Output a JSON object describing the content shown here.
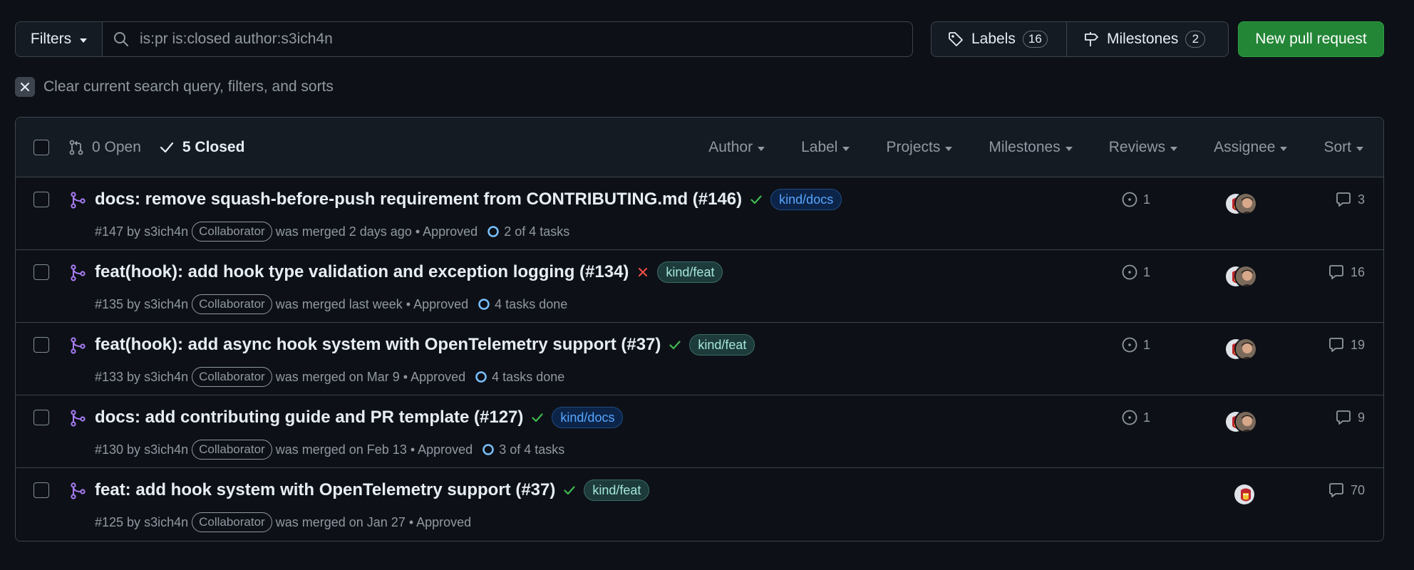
{
  "toolbar": {
    "filters_label": "Filters",
    "search_value": "is:pr is:closed author:s3ich4n",
    "labels_label": "Labels",
    "labels_count": "16",
    "milestones_label": "Milestones",
    "milestones_count": "2",
    "new_pr_label": "New pull request"
  },
  "clear_filters": "Clear current search query, filters, and sorts",
  "header": {
    "open_label": "0 Open",
    "closed_label": "5 Closed",
    "filters": [
      "Author",
      "Label",
      "Projects",
      "Milestones",
      "Reviews",
      "Assignee",
      "Sort"
    ]
  },
  "prs": [
    {
      "title": "docs: remove squash-before-push requirement from CONTRIBUTING.md (#146)",
      "status": "success",
      "label": "kind/docs",
      "number": "#147 by",
      "author": "s3ich4n",
      "role": "Collaborator",
      "merged": "was merged 2 days ago • Approved",
      "tasks": "2 of 4 tasks",
      "linked": "1",
      "comments": "3"
    },
    {
      "title": "feat(hook): add hook type validation and exception logging (#134)",
      "status": "failure",
      "label": "kind/feat",
      "number": "#135 by",
      "author": "s3ich4n",
      "role": "Collaborator",
      "merged": "was merged last week • Approved",
      "tasks": "4 tasks done",
      "linked": "1",
      "comments": "16"
    },
    {
      "title": "feat(hook): add async hook system with OpenTelemetry support (#37)",
      "status": "success",
      "label": "kind/feat",
      "number": "#133 by",
      "author": "s3ich4n",
      "role": "Collaborator",
      "merged": "was merged on Mar 9 • Approved",
      "tasks": "4 tasks done",
      "linked": "1",
      "comments": "19"
    },
    {
      "title": "docs: add contributing guide and PR template (#127)",
      "status": "success",
      "label": "kind/docs",
      "number": "#130 by",
      "author": "s3ich4n",
      "role": "Collaborator",
      "merged": "was merged on Feb 13 • Approved",
      "tasks": "3 of 4 tasks",
      "linked": "1",
      "comments": "9"
    },
    {
      "title": "feat: add hook system with OpenTelemetry support (#37)",
      "status": "success",
      "label": "kind/feat",
      "number": "#125 by",
      "author": "s3ich4n",
      "role": "Collaborator",
      "merged": "was merged on Jan 27 • Approved",
      "tasks": "",
      "linked": "",
      "comments": "70"
    }
  ],
  "colors": {
    "background": "#0d1117",
    "merged_purple": "#ab7df8",
    "success_green": "#3fb950",
    "failure_red": "#f85149",
    "primary_button": "#238636"
  }
}
